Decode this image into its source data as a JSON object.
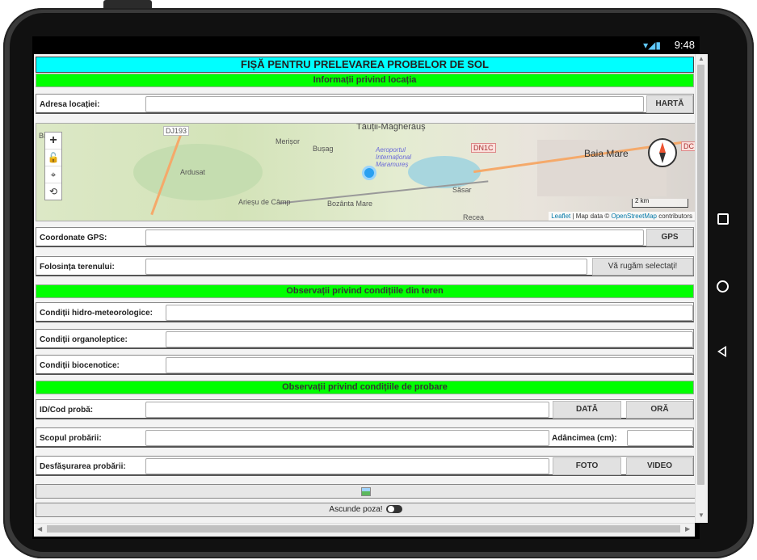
{
  "status": {
    "time": "9:48",
    "icons": "wifi-signal-battery"
  },
  "form": {
    "title": "FIȘĂ PENTRU PRELEVAREA PROBELOR DE SOL",
    "sections": {
      "location": "Informații privind locația",
      "field": "Observații privind condițiile din teren",
      "sampling": "Observații privind condițiile de probare"
    },
    "address_label": "Adresa locației:",
    "map_button": "HARTĂ",
    "gps_label": "Coordonate GPS:",
    "gps_button": "GPS",
    "landuse_label": "Folosința terenului:",
    "landuse_select": "Vă rugăm selectați!",
    "hydro_label": "Condiții hidro-meteorologice:",
    "organo_label": "Condiții organoleptice:",
    "bio_label": "Condiții biocenotice:",
    "id_label": "ID/Cod probă:",
    "date_button": "DATĂ",
    "time_button": "ORĂ",
    "purpose_label": "Scopul probării:",
    "depth_label": "Adâncimea (cm):",
    "process_label": "Desfășurarea probării:",
    "photo_button": "FOTO",
    "video_button": "VIDEO",
    "hide_photo": "Ascunde poza!"
  },
  "map": {
    "labels": [
      "DJ193",
      "Merișor",
      "Tăuții-Măgherăuș",
      "Bușag",
      "Aeroportul Internațional Maramureș",
      "DN1C",
      "Baia Mare",
      "DC",
      "Ardusat",
      "Săsar",
      "Arieșu de Câmp",
      "Bozânta Mare",
      "Recea",
      "Bic"
    ],
    "scale": "2 km",
    "attribution_leaflet": "Leaflet",
    "attribution_mid": " | Map data © ",
    "attribution_osm": "OpenStreetMap",
    "attribution_end": " contributors",
    "controls": [
      "+",
      "🔓",
      "⌖",
      "⟲"
    ]
  },
  "colors": {
    "title_bg": "#00ffff",
    "section_bg": "#00ff00"
  }
}
